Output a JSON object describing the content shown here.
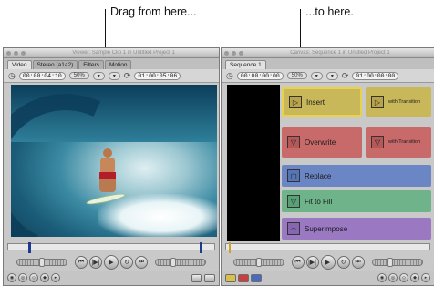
{
  "annotations": {
    "left": "Drag from here...",
    "right": "...to here."
  },
  "viewer": {
    "title": "Viewer: Sample Clip 1 in Untitled Project 1",
    "tabs": [
      "Video",
      "Stereo (a1a2)",
      "Filters",
      "Motion"
    ],
    "active_tab": "Video",
    "timecode_duration": "00:00:04:10",
    "zoom": "50%",
    "timecode_current": "01:00:05:06"
  },
  "canvas": {
    "title": "Canvas: Sequence 1 in Untitled Project 1",
    "tabs": [
      "Sequence 1"
    ],
    "timecode_duration": "00:00:00:00",
    "zoom": "50%",
    "timecode_current": "01:00:00:00"
  },
  "edit_overlay": {
    "insert": "Insert",
    "insert_with_transition": "with Transition",
    "overwrite": "Overwrite",
    "overwrite_with_transition": "with Transition",
    "replace": "Replace",
    "fit_to_fill": "Fit to Fill",
    "superimpose": "Superimpose"
  },
  "colors": {
    "insert": "#c9b85a",
    "overwrite": "#c96a6a",
    "replace": "#6a86c4",
    "fit_to_fill": "#6fb38a",
    "superimpose": "#9a78c2"
  }
}
